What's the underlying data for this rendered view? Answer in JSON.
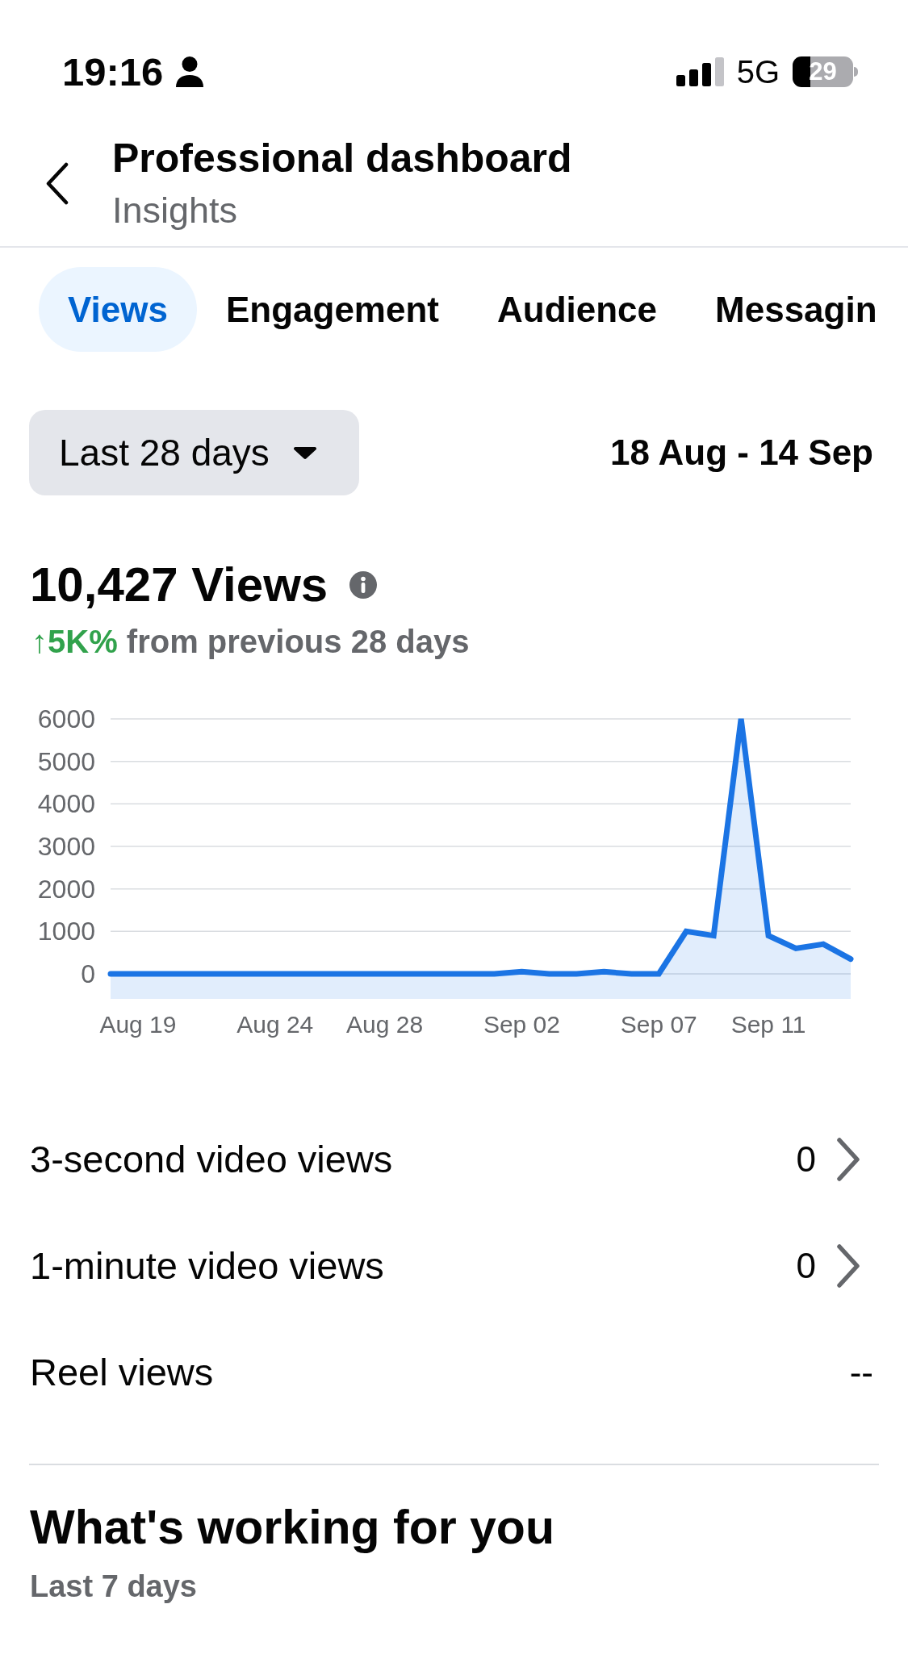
{
  "status_bar": {
    "time": "19:16",
    "network": "5G",
    "battery": "29"
  },
  "header": {
    "title": "Professional dashboard",
    "subtitle": "Insights"
  },
  "tabs": [
    {
      "label": "Views",
      "selected": true
    },
    {
      "label": "Engagement",
      "selected": false
    },
    {
      "label": "Audience",
      "selected": false
    },
    {
      "label": "Messagin",
      "selected": false
    }
  ],
  "date_range": {
    "dropdown": "Last 28 days",
    "range": "18 Aug - 14 Sep"
  },
  "views_summary": {
    "total": "10,427 Views",
    "change": "↑5K%",
    "change_text": "from previous 28 days",
    "chart_data": {
      "type": "area",
      "categories": [
        null,
        "Aug 19",
        null,
        null,
        null,
        null,
        "Aug 24",
        null,
        null,
        null,
        "Aug 28",
        null,
        null,
        null,
        null,
        "Sep 02",
        null,
        null,
        null,
        null,
        "Sep 07",
        null,
        null,
        null,
        "Sep 11",
        null,
        null,
        null
      ],
      "series": [
        {
          "color": "#1b74e4",
          "values": [
            0,
            0,
            0,
            0,
            0,
            0,
            0,
            0,
            0,
            0,
            0,
            0,
            0,
            0,
            0,
            50,
            0,
            0,
            50,
            0,
            0,
            1000,
            900,
            6000,
            900,
            600,
            700,
            350
          ]
        }
      ],
      "ylim": [
        0,
        6000
      ],
      "yticks": [
        0,
        1000,
        2000,
        3000,
        4000,
        5000,
        6000
      ],
      "grid": true
    }
  },
  "metrics": [
    {
      "kind": "link",
      "label": "3-second video views",
      "value": "0"
    },
    {
      "kind": "link",
      "label": "1-minute video views",
      "value": "0"
    },
    {
      "kind": "plain",
      "label": "Reel views",
      "value": "--"
    }
  ],
  "section": {
    "title": "What's working for you",
    "subtitle": "Last 7 days"
  }
}
